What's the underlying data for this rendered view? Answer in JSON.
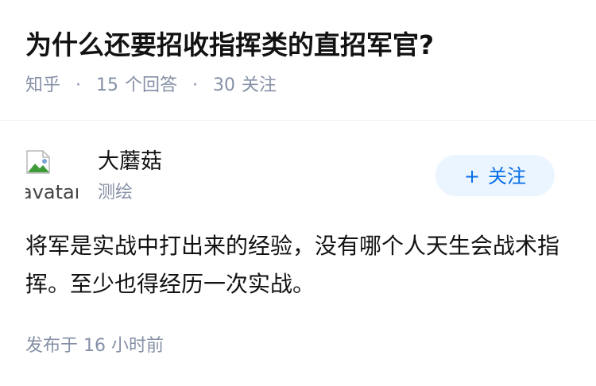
{
  "question": {
    "title": "为什么还要招收指挥类的直招军官?",
    "source": "知乎",
    "answer_count": "15",
    "answer_label": "个回答",
    "follower_count": "30",
    "follower_label": "关注"
  },
  "author": {
    "avatar_alt": "avatar",
    "name": "大蘑菇",
    "tagline": "测绘",
    "follow_icon": "+",
    "follow_label": "关注"
  },
  "answer": {
    "text": "将军是实战中打出来的经验，没有哪个人天生会战术指挥。至少也得经历一次实战。",
    "published_label": "发布于",
    "published_time": "16 小时前"
  },
  "colors": {
    "title": "#121212",
    "meta": "#8590a6",
    "follow_bg": "#ebf5ff",
    "follow_text": "#056de8"
  }
}
